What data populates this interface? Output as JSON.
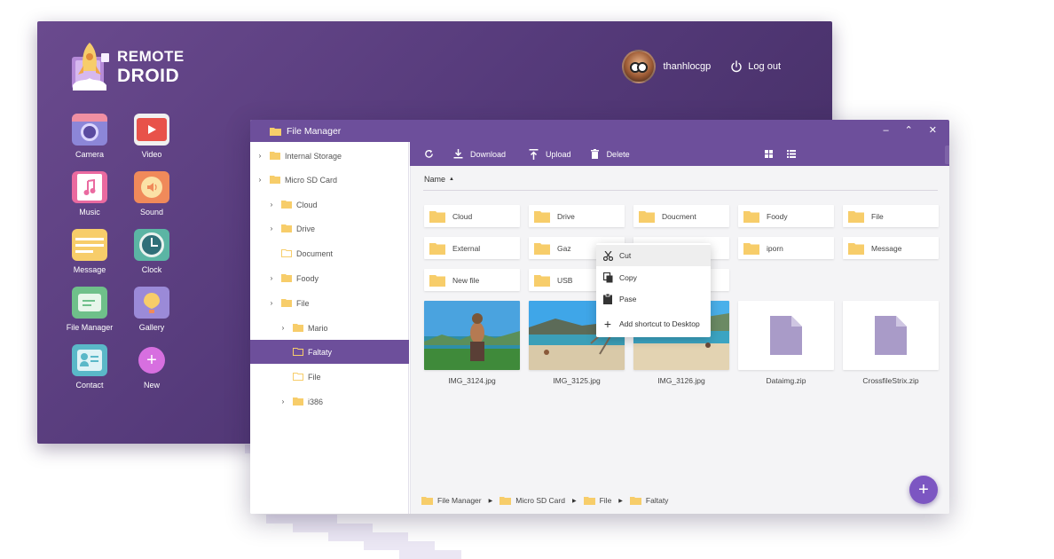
{
  "brand": {
    "line1": "REMOTE",
    "line2": "DROID"
  },
  "user": {
    "name": "thanhlocgp",
    "logout_label": "Log out"
  },
  "apps": [
    {
      "label": "Camera",
      "icon": "camera-icon"
    },
    {
      "label": "Video",
      "icon": "video-icon"
    },
    {
      "label": "Music",
      "icon": "music-icon"
    },
    {
      "label": "Sound",
      "icon": "sound-icon"
    },
    {
      "label": "Message",
      "icon": "message-icon"
    },
    {
      "label": "Clock",
      "icon": "clock-icon"
    },
    {
      "label": "File Manager",
      "icon": "file-manager-icon"
    },
    {
      "label": "Gallery",
      "icon": "gallery-icon"
    },
    {
      "label": "Contact",
      "icon": "contact-icon"
    },
    {
      "label": "New",
      "icon": "plus-icon"
    }
  ],
  "window": {
    "title": "File Manager"
  },
  "sidebar": {
    "items": [
      {
        "label": "Internal Storage",
        "arrow": true
      },
      {
        "label": "Micro SD Card",
        "arrow": true
      },
      {
        "label": "Cloud",
        "arrow": true
      },
      {
        "label": "Drive",
        "arrow": true
      },
      {
        "label": "Document",
        "arrow": false
      },
      {
        "label": "Foody",
        "arrow": true
      },
      {
        "label": "File",
        "arrow": true
      },
      {
        "label": "Mario",
        "arrow": true
      },
      {
        "label": "Faltaty",
        "arrow": false
      },
      {
        "label": "File",
        "arrow": false
      },
      {
        "label": "i386",
        "arrow": true
      }
    ]
  },
  "toolbar": {
    "download": "Download",
    "upload": "Upload",
    "delete": "Delete"
  },
  "content": {
    "sort_label": "Name",
    "folders": [
      "Cloud",
      "Drive",
      "Doucment",
      "Foody",
      "File",
      "External",
      "Gaz",
      "",
      "iporn",
      "Message",
      "New file",
      "USB"
    ],
    "files": [
      "IMG_3124.jpg",
      "IMG_3125.jpg",
      "IMG_3126.jpg",
      "Dataimg.zip",
      "CrossfileStrix.zip"
    ]
  },
  "context_menu": {
    "items": [
      "Cut",
      "Copy",
      "Pase",
      "Add shortcut to Desktop"
    ]
  },
  "breadcrumb": [
    "File Manager",
    "Micro SD Card",
    "File",
    "Faltaty"
  ],
  "colors": {
    "accent": "#6d4f9b",
    "desktop": "#553a7a",
    "folder": "#f7cd6a",
    "fab": "#7c56c2"
  }
}
